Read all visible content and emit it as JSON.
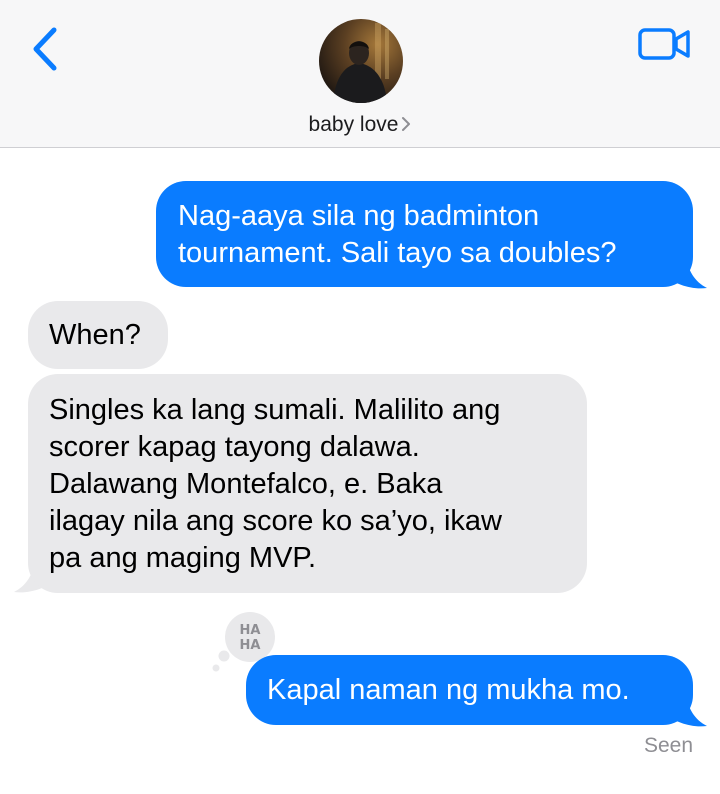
{
  "header": {
    "contact_name": "baby love",
    "back_icon": "chevron-left-icon",
    "video_icon": "video-camera-icon",
    "accent_color": "#0a7cff"
  },
  "messages": [
    {
      "direction": "outgoing",
      "text": "Nag-aaya sila ng badminton tournament. Sali tayo sa doubles?",
      "lines": [
        "Nag-aaya sila ng badminton",
        "tournament. Sali tayo sa doubles?"
      ]
    },
    {
      "direction": "incoming",
      "text": "When?"
    },
    {
      "direction": "incoming",
      "text": "Singles ka lang sumali. Malilito ang scorer kapag tayong dalawa. Dalawang Montefalco, e. Baka ilagay nila ang score ko sa’yo, ikaw pa ang maging MVP.",
      "lines": [
        "Singles ka lang sumali. Malilito ang",
        "scorer kapag tayong dalawa.",
        "Dalawang Montefalco, e. Baka",
        "ilagay nila ang score ko sa’yo, ikaw",
        "pa ang maging MVP."
      ]
    },
    {
      "direction": "outgoing",
      "text": "Kapal naman ng mukha mo.",
      "tapback": "HA HA"
    }
  ],
  "tapback_lines": [
    "HA",
    "HA"
  ],
  "status": "Seen",
  "colors": {
    "outgoing_bubble": "#0a7cff",
    "incoming_bubble": "#e9e9eb",
    "header_bg": "#f7f7f8",
    "seen_text": "#8e8e93"
  }
}
